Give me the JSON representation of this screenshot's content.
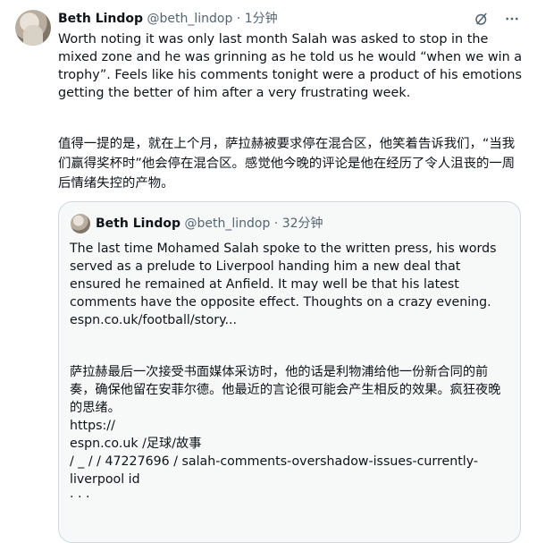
{
  "tweet": {
    "author_name": "Beth Lindop",
    "handle": "@beth_lindop",
    "separator": " · ",
    "time": "1分钟",
    "english_text": "Worth noting it was only last month Salah was asked to stop in the mixed zone and he was grinning as he told us he would “when we win a trophy”. Feels like his comments tonight were a product of his emotions getting the better of him after a very frustrating week.",
    "chinese_text": "值得一提的是，就在上个月，萨拉赫被要求停在混合区，他笑着告诉我们，“当我们赢得奖杯时”他会停在混合区。感觉他今晚的评论是他在经历了令人沮丧的一周后情绪失控的产物。"
  },
  "quoted": {
    "author_name": "Beth Lindop",
    "handle": "@beth_lindop",
    "separator": " · ",
    "time": "32分钟",
    "english_text": "The last time Mohamed Salah spoke to the written press, his words served as a prelude to Liverpool handing him a new deal that ensured he remained at Anfield. It may well be that his latest comments have the opposite effect. Thoughts on a crazy evening.",
    "link_text": "espn.co.uk/football/story...",
    "chinese_text": "萨拉赫最后一次接受书面媒体采访时，他的话是利物浦给他一份新合同的前奏，确保他留在安菲尔德。他最近的言论很可能会产生相反的效果。疯狂夜晚的思绪。",
    "url_line1": "https://",
    "url_line2": "espn.co.uk /足球/故事",
    "url_line3": "/ _ / / 47227696 / salah-comments-overshadow-issues-currently-liverpool id",
    "ellipsis": "· · ·"
  },
  "icons": [
    "grok-icon",
    "more-icon"
  ]
}
